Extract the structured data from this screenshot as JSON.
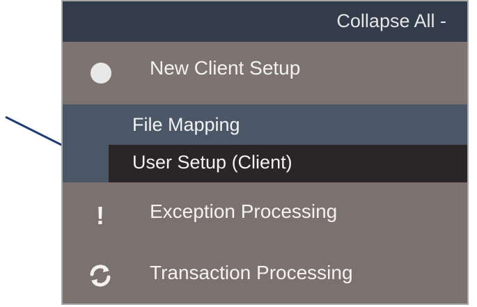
{
  "header": {
    "collapse_label": "Collapse All -"
  },
  "menu": {
    "items": [
      {
        "label": "New Client Setup",
        "icon": "circle-icon"
      },
      {
        "label": "Exception Processing",
        "icon": "exclamation-icon"
      },
      {
        "label": "Transaction Processing",
        "icon": "sync-icon"
      }
    ],
    "submenu": [
      {
        "label": "File Mapping"
      },
      {
        "label": "User Setup (Client)",
        "selected": true
      }
    ]
  },
  "colors": {
    "header_bg": "#323c4a",
    "menu_bg": "#7b716f",
    "submenu_bg": "#4b5767",
    "selected_bg": "#2a2628",
    "arrow": "#1f3a78"
  }
}
